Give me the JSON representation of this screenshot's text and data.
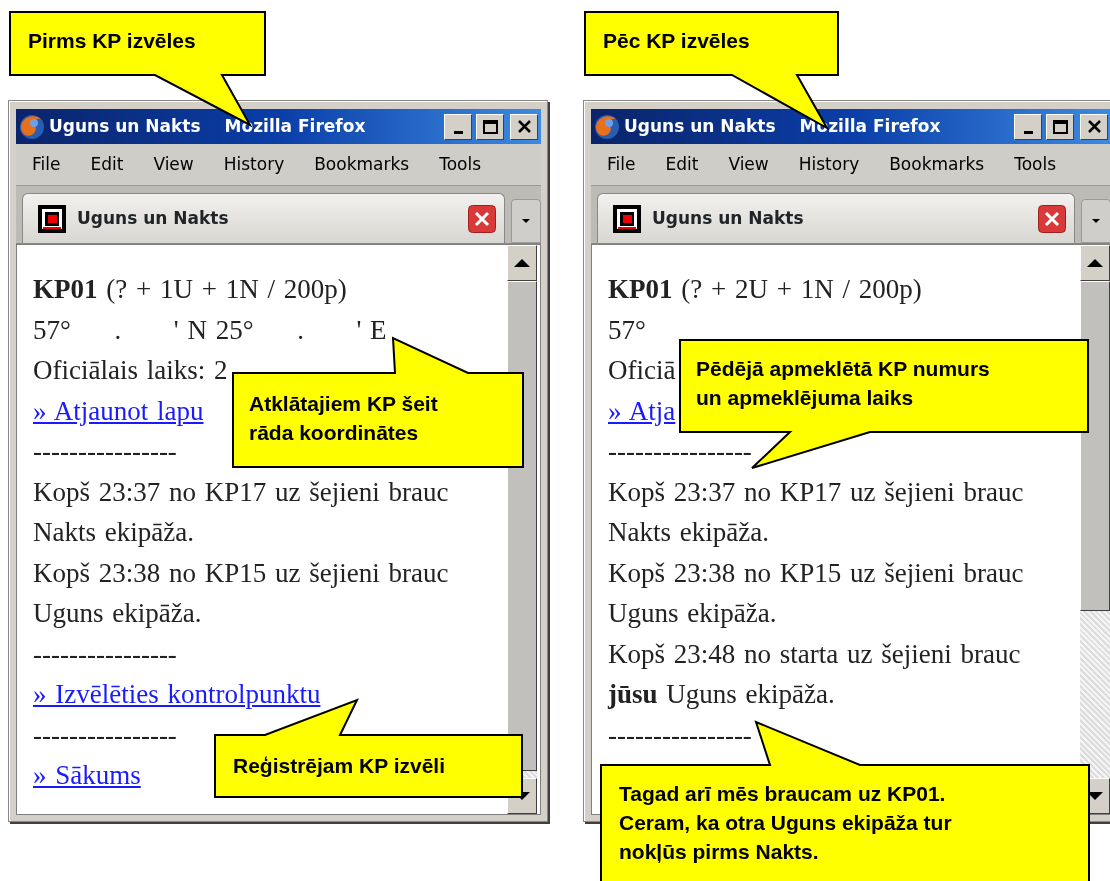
{
  "panels": [
    {
      "window": {
        "title_parts": [
          "Uguns un Nakts",
          "Mozilla Firefox"
        ],
        "menu": [
          "File",
          "Edit",
          "View",
          "History",
          "Bookmarks",
          "Tools"
        ],
        "tab": {
          "label": "Uguns un Nakts",
          "selected": true
        },
        "content": [
          {
            "kind": "text",
            "text": "**KP01** (? + 1U + 1N / 200p)"
          },
          {
            "kind": "text",
            "text": "57°     .      ' N 25°     .      ' E"
          },
          {
            "kind": "text",
            "text": "Oficiālais laiks: 2"
          },
          {
            "kind": "link",
            "text": "» Atjaunot lapu"
          },
          {
            "kind": "separator",
            "text": "----------------"
          },
          {
            "kind": "text",
            "text": "Kopš 23:37 no KP17 uz šejieni brauc Nakts ekipāža."
          },
          {
            "kind": "text",
            "text": "Kopš 23:38 no KP15 uz šejieni brauc Uguns ekipāža."
          },
          {
            "kind": "separator",
            "text": "----------------"
          },
          {
            "kind": "link",
            "text": "» Izvēlēties kontrolpunktu"
          },
          {
            "kind": "separator",
            "text": "----------------"
          },
          {
            "kind": "link",
            "text": "» Sākums"
          }
        ]
      },
      "callouts": [
        "Pirms KP izvēles",
        "Atklātajiem KP šeit rāda koordinātes",
        "Reģistrējam KP izvēli"
      ]
    },
    {
      "window": {
        "title_parts": [
          "Uguns un Nakts",
          "Mozilla Firefox"
        ],
        "menu": [
          "File",
          "Edit",
          "View",
          "History",
          "Bookmarks",
          "Tools"
        ],
        "tab": {
          "label": "Uguns un Nakts",
          "selected": true
        },
        "content": [
          {
            "kind": "text",
            "text": "**KP01** (? + 2U + 1N / 200p)"
          },
          {
            "kind": "text",
            "text": "57°"
          },
          {
            "kind": "text",
            "text": "Oficiā"
          },
          {
            "kind": "link",
            "text": "» Atja"
          },
          {
            "kind": "separator",
            "text": "----------------"
          },
          {
            "kind": "text",
            "text": "Kopš 23:37 no KP17 uz šejieni brauc Nakts ekipāža."
          },
          {
            "kind": "text",
            "text": "Kopš 23:38 no KP15 uz šejieni brauc Uguns ekipāža."
          },
          {
            "kind": "text",
            "text": "Kopš 23:48 no starta uz šejieni brauc **jūsu** Uguns ekipāža."
          },
          {
            "kind": "separator",
            "text": "----------------"
          }
        ]
      },
      "callouts": [
        "Pēc KP izvēles",
        "Pēdējā apmeklētā KP numurs un apmeklējuma laiks",
        "Tagad arī mēs braucam uz KP01. Ceram, ka otra Uguns ekipāža tur nokļūs pirms Nakts."
      ]
    }
  ]
}
